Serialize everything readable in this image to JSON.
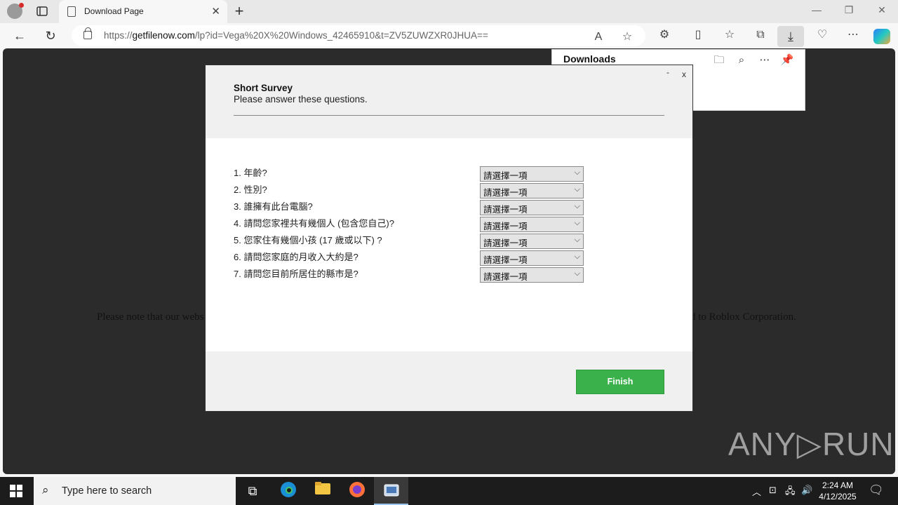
{
  "browser": {
    "tab_title": "Download Page",
    "tab_close": "✕",
    "new_tab": "+",
    "url_prefix": "https://",
    "url_host": "getfilenow.com",
    "url_path": "/lp?id=Vega%20X%20Windows_42465910&t=ZV5ZUWZXR0JHUA==",
    "minimize": "—",
    "restore": "❐",
    "close": "✕"
  },
  "downloads_panel": {
    "title": "Downloads"
  },
  "page": {
    "notice_left": "Please note that our webs",
    "notice_right": "d to Roblox Corporation."
  },
  "survey": {
    "minimize": "-",
    "close": "x",
    "title": "Short Survey",
    "subtitle": "Please answer these questions.",
    "placeholder": "請選擇一項",
    "questions": [
      "1. 年齡?",
      "2. 性別?",
      "3. 誰擁有此台電腦?",
      "4. 請問您家裡共有幾個人 (包含您自己)?",
      "5. 您家住有幾個小孩 (17 歲或以下) ?",
      "6. 請問您家庭的月收入大約是?",
      "7. 請問您目前所居住的縣市是?"
    ],
    "finish_label": "Finish"
  },
  "watermark": "ANY▷RUN",
  "taskbar": {
    "search_placeholder": "Type here to search",
    "time": "2:24 AM",
    "date": "4/12/2025"
  }
}
